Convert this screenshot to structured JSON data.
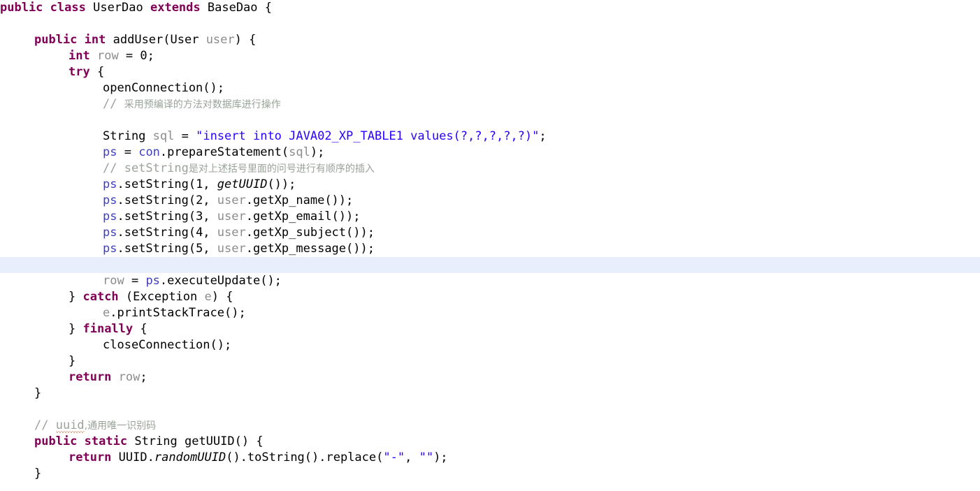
{
  "editor": {
    "language": "java",
    "class_name": "UserDao",
    "theme": {
      "background": "#ffffff",
      "keyword": "#7f0055",
      "string": "#2a00ff",
      "comment": "#9aa39a",
      "field": "#3f3fbf",
      "parameter": "#8c8c8c",
      "local_variable": "#8c8c8c",
      "plain_text": "#000000",
      "highlight_line": "#e8eefc",
      "spellcheck_underline": "#d06a3a"
    },
    "highlighted_line_number": 17,
    "lines": [
      {
        "n": 1,
        "indent": 0,
        "text": "public class UserDao extends BaseDao {"
      },
      {
        "n": 2,
        "indent": 0,
        "text": ""
      },
      {
        "n": 3,
        "indent": 1,
        "text": "public int addUser(User user) {"
      },
      {
        "n": 4,
        "indent": 2,
        "text": "int row = 0;"
      },
      {
        "n": 5,
        "indent": 2,
        "text": "try {"
      },
      {
        "n": 6,
        "indent": 3,
        "text": "openConnection();"
      },
      {
        "n": 7,
        "indent": 3,
        "text": "// 采用预编译的方法对数据库进行操作"
      },
      {
        "n": 8,
        "indent": 0,
        "text": ""
      },
      {
        "n": 9,
        "indent": 3,
        "text": "String sql = \"insert into JAVA02_XP_TABLE1 values(?,?,?,?,?)\";"
      },
      {
        "n": 10,
        "indent": 3,
        "text": "ps = con.prepareStatement(sql);"
      },
      {
        "n": 11,
        "indent": 3,
        "text": "// setString是对上述括号里面的问号进行有顺序的插入"
      },
      {
        "n": 12,
        "indent": 3,
        "text": "ps.setString(1, getUUID());"
      },
      {
        "n": 13,
        "indent": 3,
        "text": "ps.setString(2, user.getXp_name());"
      },
      {
        "n": 14,
        "indent": 3,
        "text": "ps.setString(3, user.getXp_email());"
      },
      {
        "n": 15,
        "indent": 3,
        "text": "ps.setString(4, user.getXp_subject());"
      },
      {
        "n": 16,
        "indent": 3,
        "text": "ps.setString(5, user.getXp_message());"
      },
      {
        "n": 17,
        "indent": 0,
        "text": ""
      },
      {
        "n": 18,
        "indent": 3,
        "text": "row = ps.executeUpdate();"
      },
      {
        "n": 19,
        "indent": 2,
        "text": "} catch (Exception e) {"
      },
      {
        "n": 20,
        "indent": 3,
        "text": "e.printStackTrace();"
      },
      {
        "n": 21,
        "indent": 2,
        "text": "} finally {"
      },
      {
        "n": 22,
        "indent": 3,
        "text": "closeConnection();"
      },
      {
        "n": 23,
        "indent": 2,
        "text": "}"
      },
      {
        "n": 24,
        "indent": 2,
        "text": "return row;"
      },
      {
        "n": 25,
        "indent": 1,
        "text": "}"
      },
      {
        "n": 26,
        "indent": 0,
        "text": ""
      },
      {
        "n": 27,
        "indent": 1,
        "text": "// uuid,通用唯一识别码"
      },
      {
        "n": 28,
        "indent": 1,
        "text": "public static String getUUID() {"
      },
      {
        "n": 29,
        "indent": 2,
        "text": "return UUID.randomUUID().toString().replace(\"-\", \"\");"
      },
      {
        "n": 30,
        "indent": 1,
        "text": "}"
      }
    ],
    "tokens": {
      "keywords": [
        "public",
        "class",
        "extends",
        "int",
        "try",
        "catch",
        "finally",
        "return",
        "static"
      ],
      "types": [
        "UserDao",
        "BaseDao",
        "User",
        "String",
        "Exception",
        "UUID"
      ],
      "fields": [
        "ps",
        "con"
      ],
      "parameters": [
        "user",
        "e"
      ],
      "locals": [
        "row",
        "sql"
      ],
      "static_methods": [
        "getUUID",
        "randomUUID"
      ],
      "string_literals": [
        "\"insert into JAVA02_XP_TABLE1 values(?,?,?,?,?)\"",
        "\"-\"",
        "\"\""
      ],
      "comments": [
        "// 采用预编译的方法对数据库进行操作",
        "// setString是对上述括号里面的问号进行有顺序的插入",
        "// uuid,通用唯一识别码"
      ],
      "misspelled_words": [
        "uuid"
      ]
    }
  }
}
